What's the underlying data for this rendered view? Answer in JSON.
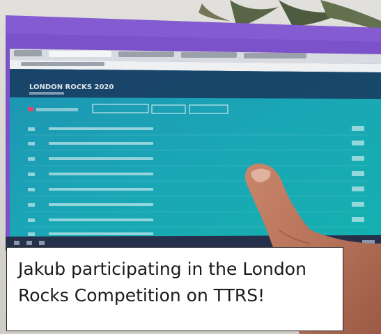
{
  "photo": {
    "subject": "hand-pointing-at-laptop-screen"
  },
  "screen": {
    "heading": "LONDON ROCKS 2020"
  },
  "caption": {
    "line1": "Jakub participating in the London",
    "line2": "Rocks Competition on TTRS!"
  },
  "colors": {
    "laptop_frame": "#7b52c9",
    "screen_teal": "#1aa6b5",
    "screen_dark": "#17365c",
    "caption_bg": "#ffffff"
  }
}
